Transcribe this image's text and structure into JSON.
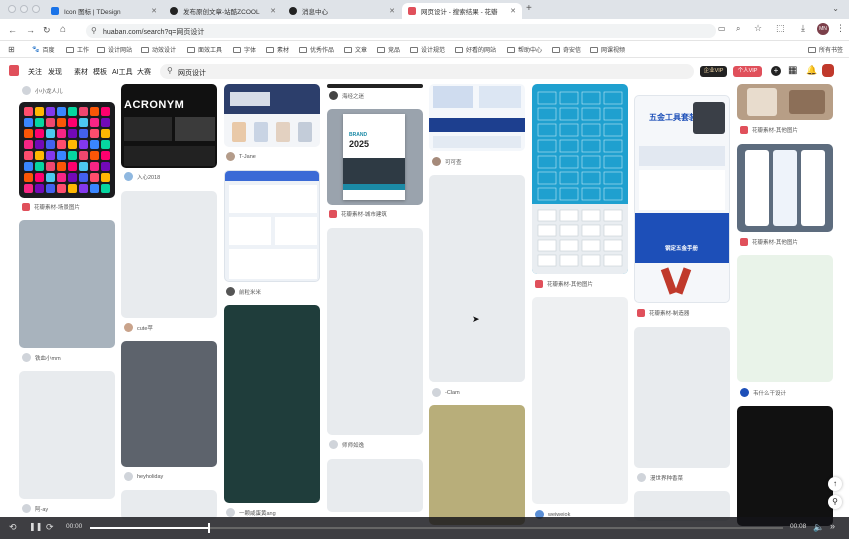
{
  "browser": {
    "tabs": [
      {
        "title": "Icon 图标 | TDesign",
        "color": "#1a73e8"
      },
      {
        "title": "发布原创文章-站酷ZCOOL",
        "color": "#222222"
      },
      {
        "title": "消息中心",
        "color": "#222222"
      },
      {
        "title": "网页设计 - 搜索结果 - 花瓣",
        "color": "#e0505b"
      }
    ],
    "url": "huaban.com/search?q=网页设计",
    "profile": "MN",
    "bookmarks": [
      "百度",
      "工作",
      "设计网站",
      "动效设计",
      "面效工具",
      "字体",
      "素材",
      "优秀作品",
      "文章",
      "竞品",
      "设计规范",
      "好看的网站",
      "帮助中心",
      "奇安信",
      "网课视频"
    ],
    "all_bookmarks": "所有书签"
  },
  "site": {
    "nav": [
      "关注",
      "发现",
      "素材",
      "模板",
      "AI工具",
      "大赛"
    ],
    "search_value": "网页设计",
    "vip": "企业VIP",
    "personal": "个人VIP"
  },
  "pins": {
    "c1": [
      {
        "cap": "小小龙人儿"
      },
      {
        "cap": "花瓣素材-场景图片"
      },
      {
        "cap": "铁血小mm"
      },
      {
        "cap": "阿-ay"
      }
    ],
    "c2": [
      {
        "cap": "ACRONYM"
      },
      {
        "cap": "入心2018"
      },
      {
        "cap": "cute苹"
      },
      {
        "cap": "heyholiday"
      }
    ],
    "c3": [
      {
        "cap": "T-Jane"
      },
      {
        "cap": "前粒米米"
      },
      {
        "cap": "一颗咸蛋黄ang"
      }
    ],
    "c4": [
      {
        "cap": "海经之迷"
      },
      {
        "cap": "花瓣素材-城市建筑"
      },
      {
        "cap": "师师如逸"
      }
    ],
    "c5": [
      {
        "cap": "可可查"
      },
      {
        "cap": "-Clam"
      }
    ],
    "c6": [
      {
        "cap": "花瓣素材-其他图片"
      },
      {
        "cap": "weiweiok"
      }
    ],
    "c7": [
      {
        "cap": "花瓣素材-制造器"
      },
      {
        "cap": "漫世界种香菜"
      }
    ],
    "c8": [
      {
        "cap": "花瓣素材-其他图片"
      },
      {
        "cap": "花瓣素材-其他图片"
      },
      {
        "cap": "韦什么干设计"
      }
    ]
  },
  "poster": {
    "title": "五金工具套装",
    "sub": "钢定五金手册"
  },
  "brochure": {
    "year": "2025",
    "tag": "BRAND"
  },
  "video": {
    "current": "00:00",
    "duration": "00:08",
    "progress": 0.17
  }
}
